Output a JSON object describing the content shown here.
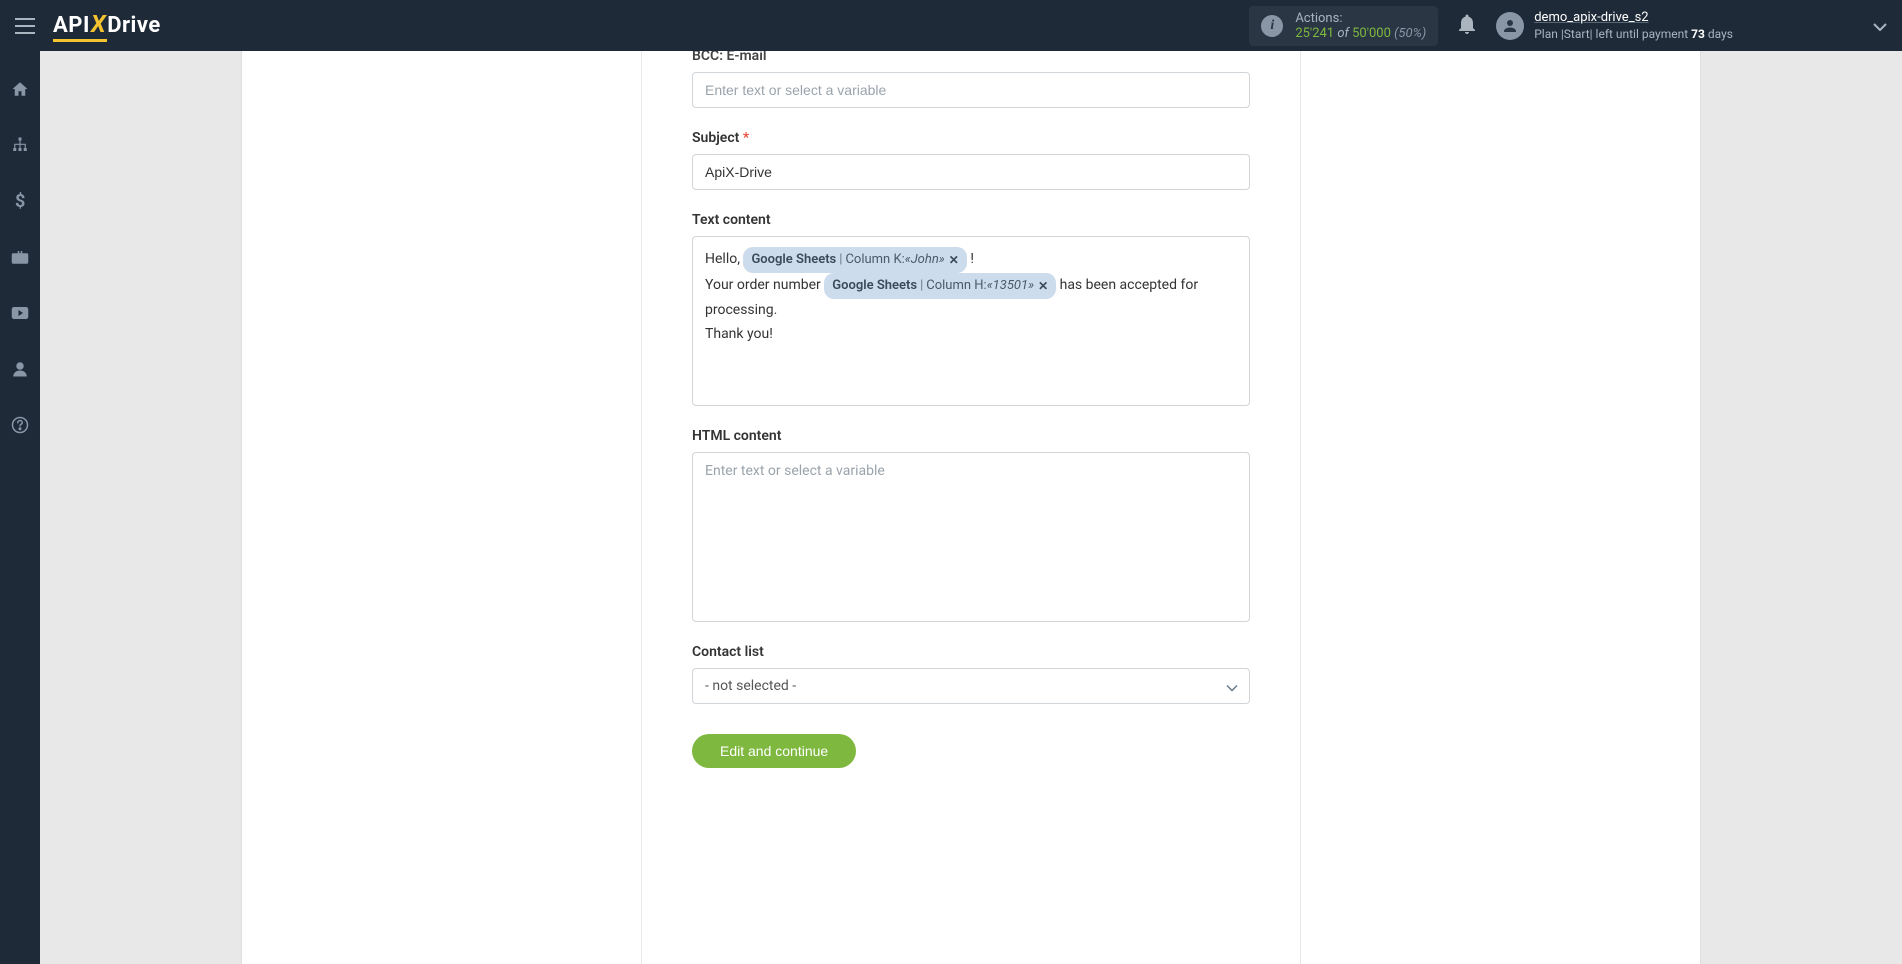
{
  "header": {
    "logo": {
      "api": "API",
      "x": "X",
      "drive": "Drive"
    },
    "actions": {
      "label": "Actions:",
      "current": "25'241",
      "of": " of ",
      "total": "50'000",
      "pct": " (50%)"
    },
    "user": {
      "name": "demo_apix-drive_s2",
      "plan_prefix": "Plan |Start| left until payment ",
      "days_num": "73",
      "days_suffix": " days"
    }
  },
  "form": {
    "bcc": {
      "label": "BCC: E-mail",
      "placeholder": "Enter text or select a variable"
    },
    "subject": {
      "label": "Subject",
      "value": "ApiX-Drive"
    },
    "text_content": {
      "label": "Text content",
      "line1_prefix": "Hello, ",
      "chip1_source": "Google Sheets",
      "chip1_col": "Column K: ",
      "chip1_val": "«John»",
      "line1_suffix": " !",
      "line2_prefix": "Your order number ",
      "chip2_source": "Google Sheets",
      "chip2_col": "Column H: ",
      "chip2_val": "«13501»",
      "line2_suffix": " has been accepted for processing.",
      "line3": "Thank you!"
    },
    "html_content": {
      "label": "HTML content",
      "placeholder": "Enter text or select a variable"
    },
    "contact_list": {
      "label": "Contact list",
      "selected": "- not selected -"
    },
    "submit": "Edit and continue"
  }
}
